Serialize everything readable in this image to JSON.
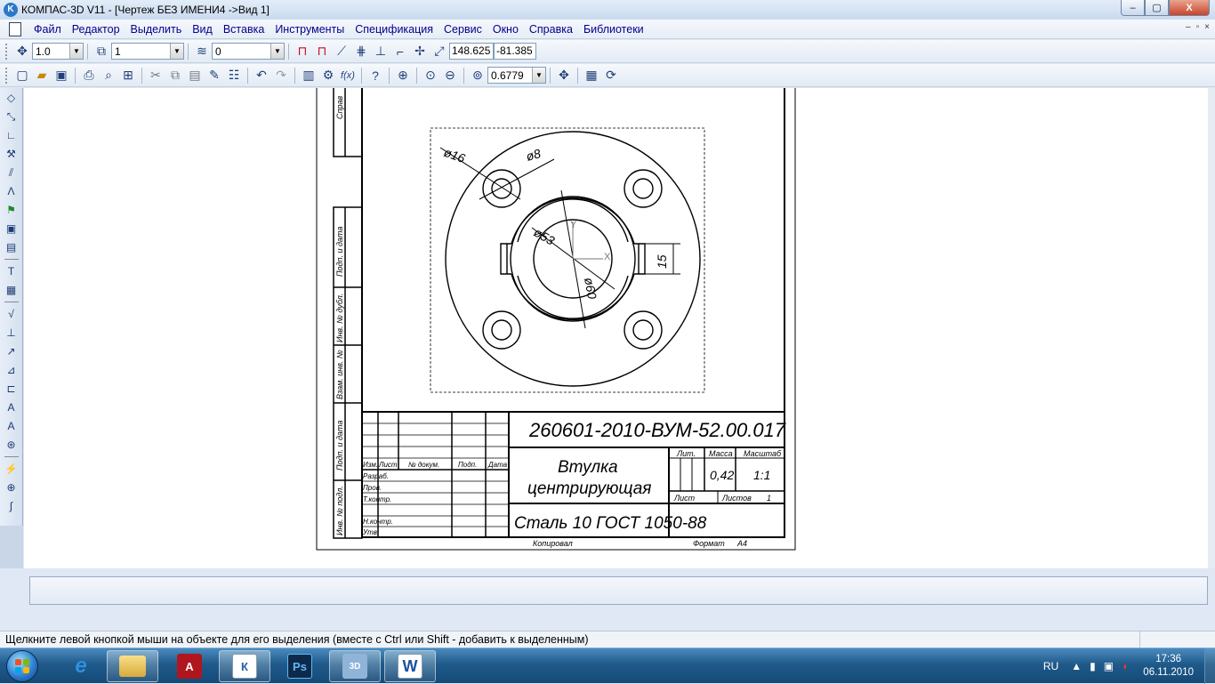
{
  "window": {
    "title": "КОМПАС-3D V11 - [Чертеж БЕЗ ИМЕНИ4 ->Вид 1]",
    "minimize": "–",
    "maximize": "▢",
    "close": "X"
  },
  "menu": [
    "Файл",
    "Редактор",
    "Выделить",
    "Вид",
    "Вставка",
    "Инструменты",
    "Спецификация",
    "Сервис",
    "Окно",
    "Справка",
    "Библиотеки"
  ],
  "mdi_controls": [
    "–",
    "▫",
    "×"
  ],
  "toolbar1": {
    "step_value": "1.0",
    "layer_value": "1",
    "style_value": "0",
    "coord_x": "148.625",
    "coord_y": "-81.385"
  },
  "toolbar2": {
    "zoom_value": "0.6779"
  },
  "drawing": {
    "dims": {
      "d16": "ø16",
      "d8": "ø8",
      "d53": "ø53",
      "d60": "ø60",
      "w15": "15",
      "axis_x": "X",
      "axis_y": "Y"
    },
    "side_stamp": {
      "sprav": "Справ",
      "podp_data_1": "Подп. и дата",
      "inv_dubl": "Инв. № дубл.",
      "vzam_inv": "Взам. инв. №",
      "podp_data_2": "Подп. и дата",
      "inv_podl": "Инв. № подл."
    },
    "title_block": {
      "designation": "260601-2010-ВУМ-52.00.017",
      "name_line1": "Втулка",
      "name_line2": "центрирующая",
      "material": "Сталь 10  ГОСТ 1050-88",
      "lit_label": "Лит.",
      "mass_label": "Масса",
      "scale_label": "Масштаб",
      "mass_value": "0,42",
      "scale_value": "1:1",
      "sheet_label": "Лист",
      "sheets_label": "Листов",
      "sheets_value": "1",
      "row_labels": [
        "Изм.",
        "Лист",
        "№ докум.",
        "Подп.",
        "Дата"
      ],
      "roles": [
        "Разраб.",
        "Пров.",
        "Т.контр.",
        "Н.контр.",
        "Утв."
      ],
      "copied": "Копировал",
      "format_label": "Формат",
      "format_value": "А4"
    }
  },
  "status": {
    "hint": "Щелкните левой кнопкой мыши на объекте для его выделения (вместе с Ctrl или Shift - добавить к выделенным)"
  },
  "taskbar": {
    "lang": "RU",
    "time": "17:36",
    "date": "06.11.2010",
    "apps": [
      {
        "name": "internet-explorer",
        "glyph": "e"
      },
      {
        "name": "file-explorer",
        "glyph": ""
      },
      {
        "name": "acrobat",
        "glyph": "A"
      },
      {
        "name": "kompas",
        "glyph": "К"
      },
      {
        "name": "photoshop",
        "glyph": "Ps"
      },
      {
        "name": "kompas-3d",
        "glyph": "3D"
      },
      {
        "name": "word",
        "glyph": "W"
      }
    ]
  },
  "colors": {
    "menu_text": "#00008b",
    "taskbar": "#1f5a8a",
    "canvas": "#ffffff"
  }
}
